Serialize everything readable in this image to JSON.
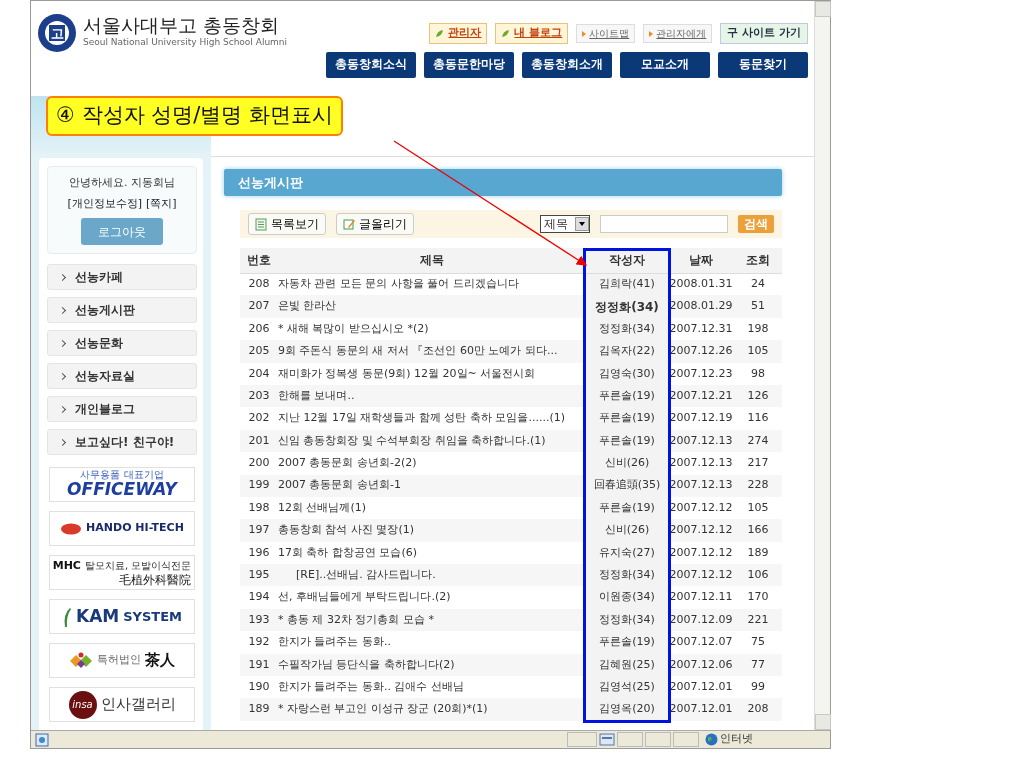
{
  "header": {
    "emblem_letter": "고",
    "logo_title": "서울사대부고 총동창회",
    "logo_subtitle": "Seoul National University High School Alumni",
    "top_links": [
      {
        "label": "관리자",
        "kind": "badge"
      },
      {
        "label": "내 블로그",
        "kind": "badge"
      },
      {
        "label": "사이트맵",
        "kind": "link"
      },
      {
        "label": "관리자에게",
        "kind": "link"
      },
      {
        "label": "구 사이트 가기",
        "kind": "button"
      }
    ],
    "nav": [
      "총동창회소식",
      "총동문한마당",
      "총동창회소개",
      "모교소개",
      "동문찾기"
    ]
  },
  "callout": {
    "text": "④ 작성자 성명/별명 화면표시"
  },
  "sidebar": {
    "greeting": "안녕하세요. 지동회님",
    "links": [
      "[개인정보수정]",
      "[쪽지]"
    ],
    "logout": "로그아웃",
    "menu": [
      "선농카페",
      "선농게시판",
      "선농문화",
      "선농자료실",
      "개인블로그",
      "보고싶다! 친구야!"
    ],
    "banners": [
      {
        "kind": "officeway",
        "subtitle": "사무용품 대표기업",
        "title": "OFFICEWAY"
      },
      {
        "kind": "hando",
        "title": "HANDO HI-TECH"
      },
      {
        "kind": "mhc",
        "mark": "MHC",
        "subtitle": "탈모치료, 모발이식전문",
        "title": "毛植外科醫院"
      },
      {
        "kind": "kam",
        "mark": "KAM",
        "title": "SYSTEM"
      },
      {
        "kind": "patent",
        "subtitle": "특허법인",
        "title": "茶人"
      },
      {
        "kind": "insa",
        "mark": "insa",
        "title": "인사갤러리"
      }
    ]
  },
  "board": {
    "title": "선농게시판",
    "buttons": [
      {
        "label": "목록보기",
        "kind": "list"
      },
      {
        "label": "글올리기",
        "kind": "write"
      }
    ],
    "search_select": "제목",
    "search_button": "검색",
    "columns": [
      "번호",
      "제목",
      "작성자",
      "날짜",
      "조회"
    ],
    "rows": [
      {
        "no": "208",
        "title": "자동차 관련 모든 문의 사항을 풀어 드리겠습니다",
        "reply": false,
        "author": "김희락(41)",
        "author_bold": false,
        "date": "2008.01.31",
        "views": "24"
      },
      {
        "no": "207",
        "title": "은빛 한라산",
        "reply": false,
        "author": "정정화(34)",
        "author_bold": true,
        "date": "2008.01.29",
        "views": "51"
      },
      {
        "no": "206",
        "title": "* 새해 복많이 받으십시오 *(2)",
        "reply": false,
        "author": "정정화(34)",
        "author_bold": false,
        "date": "2007.12.31",
        "views": "198"
      },
      {
        "no": "205",
        "title": "9회 주돈식 동문의 새 저서 『조선인 60만 노예가 되다...",
        "reply": false,
        "author": "김옥자(22)",
        "author_bold": false,
        "date": "2007.12.26",
        "views": "105"
      },
      {
        "no": "204",
        "title": "재미화가 정복생 동문(9회) 12월 20일~ 서울전시회",
        "reply": false,
        "author": "김영숙(30)",
        "author_bold": false,
        "date": "2007.12.23",
        "views": "98"
      },
      {
        "no": "203",
        "title": "한해를 보내며..",
        "reply": false,
        "author": "푸른솔(19)",
        "author_bold": false,
        "date": "2007.12.21",
        "views": "126"
      },
      {
        "no": "202",
        "title": "지난 12월 17일 재학생들과 함께 성탄 축하 모임을......(1)",
        "reply": false,
        "author": "푸른솔(19)",
        "author_bold": false,
        "date": "2007.12.19",
        "views": "116"
      },
      {
        "no": "201",
        "title": "신임 총동창회장 및 수석부회장 취임을 축하합니다.(1)",
        "reply": false,
        "author": "푸른솔(19)",
        "author_bold": false,
        "date": "2007.12.13",
        "views": "274"
      },
      {
        "no": "200",
        "title": "2007 총동문회 송년회-2(2)",
        "reply": false,
        "author": "신비(26)",
        "author_bold": false,
        "date": "2007.12.13",
        "views": "217"
      },
      {
        "no": "199",
        "title": "2007 총동문회 송년회-1",
        "reply": false,
        "author": "回春追頭(35)",
        "author_bold": false,
        "date": "2007.12.13",
        "views": "228"
      },
      {
        "no": "198",
        "title": "12회 선배님께(1)",
        "reply": false,
        "author": "푸른솔(19)",
        "author_bold": false,
        "date": "2007.12.12",
        "views": "105"
      },
      {
        "no": "197",
        "title": "총동창회 참석 사진 몇장(1)",
        "reply": false,
        "author": "신비(26)",
        "author_bold": false,
        "date": "2007.12.12",
        "views": "166"
      },
      {
        "no": "196",
        "title": "17회 축하 합창공연 모습(6)",
        "reply": false,
        "author": "유지숙(27)",
        "author_bold": false,
        "date": "2007.12.12",
        "views": "189"
      },
      {
        "no": "195",
        "title": "[RE]..선배님. 감사드립니다.",
        "reply": true,
        "author": "정정화(34)",
        "author_bold": false,
        "date": "2007.12.12",
        "views": "106"
      },
      {
        "no": "194",
        "title": "선, 후배님들에게 부탁드립니다.(2)",
        "reply": false,
        "author": "이원종(34)",
        "author_bold": false,
        "date": "2007.12.11",
        "views": "170"
      },
      {
        "no": "193",
        "title": "* 총동 제 32차 정기총회 모습 *",
        "reply": false,
        "author": "정정화(34)",
        "author_bold": false,
        "date": "2007.12.09",
        "views": "221"
      },
      {
        "no": "192",
        "title": "한지가 들려주는 동화..",
        "reply": false,
        "author": "푸른솔(19)",
        "author_bold": false,
        "date": "2007.12.07",
        "views": "75"
      },
      {
        "no": "191",
        "title": "수필작가님 등단식을 축하합니다(2)",
        "reply": false,
        "author": "김혜원(25)",
        "author_bold": false,
        "date": "2007.12.06",
        "views": "77"
      },
      {
        "no": "190",
        "title": "한지가 들려주는 동화.. 김애수 선배님",
        "reply": false,
        "author": "김영석(25)",
        "author_bold": false,
        "date": "2007.12.01",
        "views": "99"
      },
      {
        "no": "189",
        "title": "* 자랑스런 부고인 이성규 장군 (20회)*(1)",
        "reply": false,
        "author": "김영옥(20)",
        "author_bold": false,
        "date": "2007.12.01",
        "views": "208"
      }
    ]
  },
  "status_bar": {
    "zone": "인터넷"
  }
}
